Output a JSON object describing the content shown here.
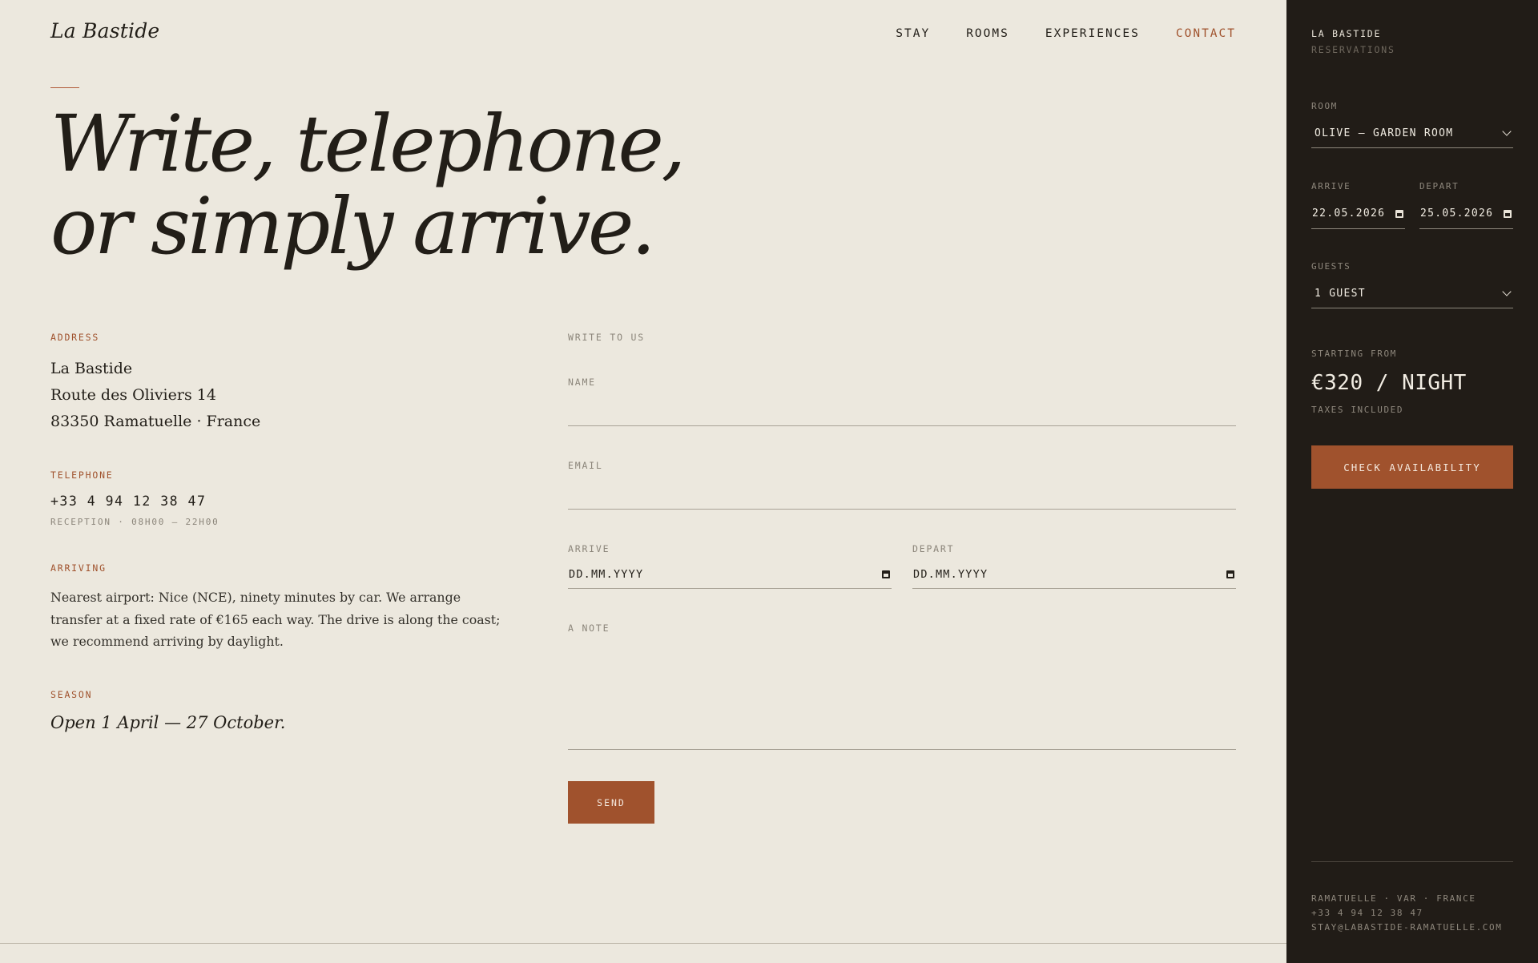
{
  "brand": "La Bastide",
  "nav": [
    {
      "label": "STAY"
    },
    {
      "label": "ROOMS"
    },
    {
      "label": "EXPERIENCES"
    },
    {
      "label": "CONTACT",
      "active": true
    }
  ],
  "hero": {
    "line1": "Write, telephone,",
    "line2": "or simply arrive."
  },
  "address": {
    "label": "ADDRESS",
    "lines": [
      "La Bastide",
      "Route des Oliviers 14",
      "83350 Ramatuelle · France"
    ]
  },
  "telephone": {
    "label": "TELEPHONE",
    "number": "+33 4 94 12 38 47",
    "note": "RECEPTION · 08H00 — 22H00"
  },
  "arriving": {
    "label": "ARRIVING",
    "text": "Nearest airport: Nice (NCE), ninety minutes by car. We arrange transfer at a fixed rate of €165 each way. The drive is along the coast; we recommend arriving by daylight."
  },
  "season": {
    "label": "SEASON",
    "text": "Open 1 April — 27 October."
  },
  "form": {
    "heading": "WRITE TO US",
    "name_label": "NAME",
    "email_label": "EMAIL",
    "arrive_label": "ARRIVE",
    "arrive_value": "DD.MM.YYYY",
    "depart_label": "DEPART",
    "depart_value": "DD.MM.YYYY",
    "note_label": "A NOTE",
    "send_label": "SEND"
  },
  "sidebar": {
    "title": "LA BASTIDE",
    "subtitle": "RESERVATIONS",
    "room_label": "ROOM",
    "room_value": "OLIVE — GARDEN ROOM",
    "arrive_label": "ARRIVE",
    "arrive_value": "22.05.2026",
    "depart_label": "DEPART",
    "depart_value": "25.05.2026",
    "guests_label": "GUESTS",
    "guests_value": "1 GUEST",
    "price_label": "STARTING FROM",
    "price": "€320 / NIGHT",
    "price_note": "TAXES INCLUDED",
    "cta": "CHECK AVAILABILITY",
    "footer": [
      "RAMATUELLE · VAR · FRANCE",
      "+33 4 94 12 38 47",
      "STAY@LABASTIDE-RAMATUELLE.COM"
    ]
  },
  "colors": {
    "accent": "#a0522d",
    "paper": "#ece8de",
    "ink": "#221e18",
    "sidebar": "#211c17"
  }
}
